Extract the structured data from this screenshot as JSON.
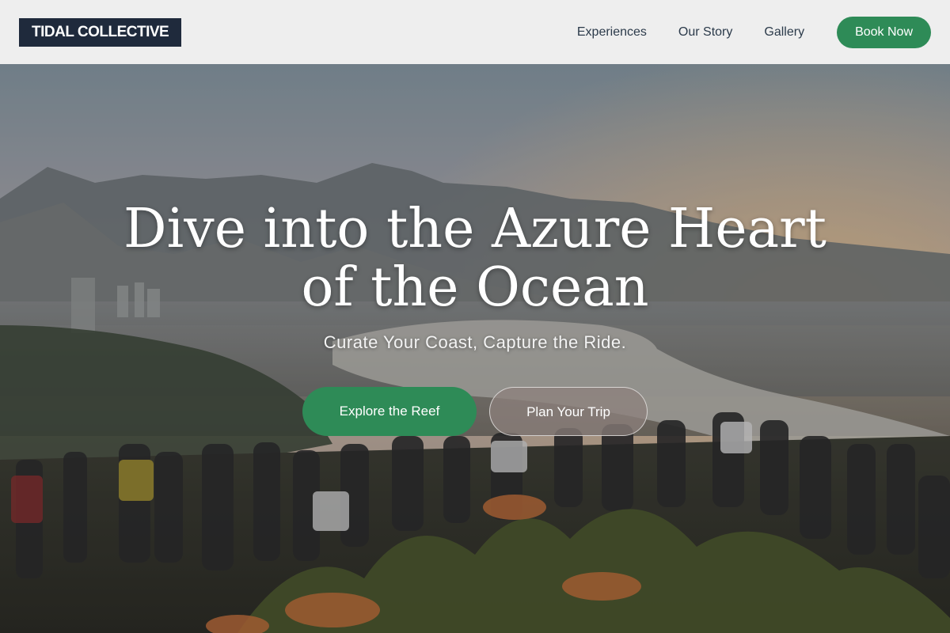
{
  "header": {
    "logo": "TIDAL COLLECTIVE",
    "nav": [
      "Experiences",
      "Our Story",
      "Gallery"
    ],
    "cta": "Book Now"
  },
  "hero": {
    "title_line1": "Dive into the Azure Heart",
    "title_line2": "of the Ocean",
    "subtitle": "Curate Your Coast, Capture the Ride.",
    "primary_cta": "Explore the Reef",
    "secondary_cta": "Plan Your Trip"
  },
  "colors": {
    "brand_dark": "#1f2a3c",
    "accent_green": "#2e8b57",
    "header_bg": "#eeeeee"
  }
}
